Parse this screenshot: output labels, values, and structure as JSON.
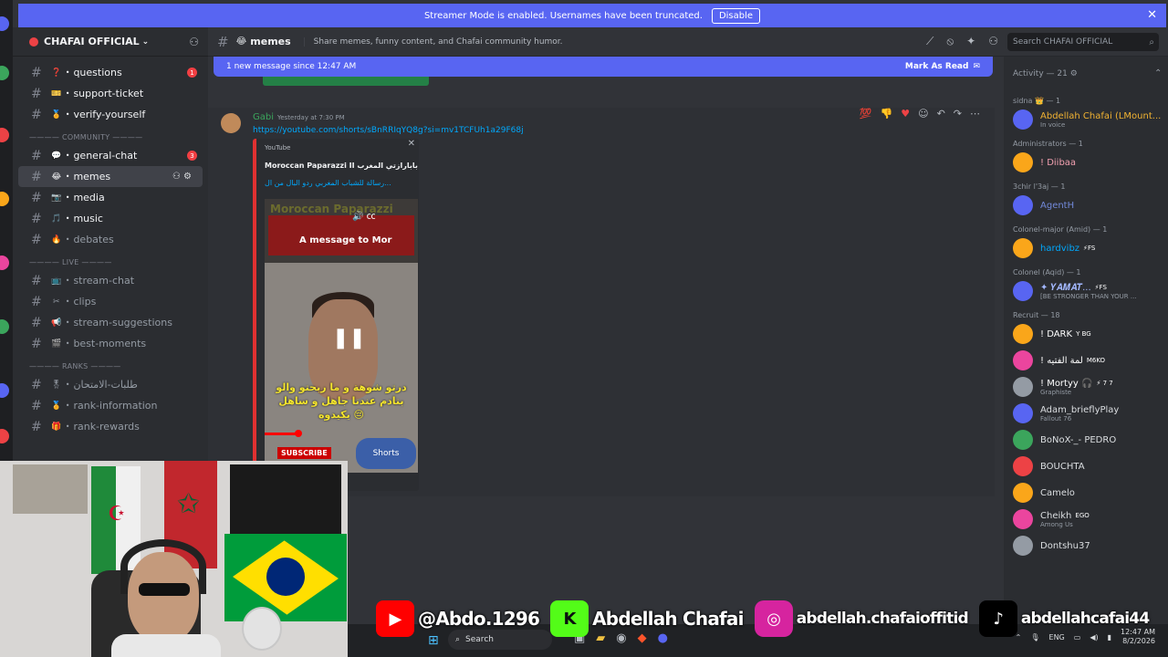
{
  "banner": {
    "text": "Streamer Mode is enabled. Usernames have been truncated.",
    "button": "Disable",
    "close": "✕"
  },
  "server": {
    "name": "CHAFAI OFFICIAL",
    "chevron": "⌄",
    "invite_icon": "person-plus-icon"
  },
  "channels": [
    {
      "type": "channel",
      "name": "questions",
      "emoji": "❓",
      "mention": "1",
      "unread": true
    },
    {
      "type": "channel",
      "name": "support-ticket",
      "emoji": "🎫",
      "unread": true
    },
    {
      "type": "channel",
      "name": "verify-yourself",
      "emoji": "🏅",
      "unread": true
    },
    {
      "type": "category",
      "name": "———— COMMUNITY ————"
    },
    {
      "type": "channel",
      "name": "general-chat",
      "emoji": "💬",
      "mention": "3",
      "unread": true
    },
    {
      "type": "channel",
      "name": "memes",
      "emoji": "😂",
      "active": true
    },
    {
      "type": "channel",
      "name": "media",
      "emoji": "📷",
      "unread": true
    },
    {
      "type": "channel",
      "name": "music",
      "emoji": "🎵",
      "unread": true
    },
    {
      "type": "channel",
      "name": "debates",
      "emoji": "🔥"
    },
    {
      "type": "category",
      "name": "———— LIVE ————"
    },
    {
      "type": "channel",
      "name": "stream-chat",
      "emoji": "📺"
    },
    {
      "type": "channel",
      "name": "clips",
      "emoji": "✂"
    },
    {
      "type": "channel",
      "name": "stream-suggestions",
      "emoji": "📢"
    },
    {
      "type": "channel",
      "name": "best-moments",
      "emoji": "🎬"
    },
    {
      "type": "category",
      "name": "———— RANKS ————"
    },
    {
      "type": "channel",
      "name": "طلبات-الامتحان",
      "emoji": "🎖"
    },
    {
      "type": "channel",
      "name": "rank-information",
      "emoji": "🏅"
    },
    {
      "type": "channel",
      "name": "rank-rewards",
      "emoji": "🎁"
    }
  ],
  "topbar": {
    "channel": "memes",
    "channel_emoji": "😂",
    "topic": "Share memes, funny content, and Chafai community humor.",
    "search_placeholder": "Search CHAFAI OFFICIAL"
  },
  "new_messages": {
    "text": "1 new message since 12:47 AM",
    "action": "Mark As Read"
  },
  "message": {
    "author": "Gabi",
    "timestamp": "Yesterday at 7:30 PM",
    "link": "https://youtube.com/shorts/sBnRRIqYQ8g?si=mv1TCFUh1a29F68j",
    "embed": {
      "provider": "YouTube",
      "title": "Moroccan Paparazzi II بابارازتي المغرب",
      "description": "رسالة للشباب المغربي ردو البال من ال...",
      "close": "✕",
      "video": {
        "channel_title": "Moroccan Paparazzi",
        "overlay": "A message to Mor",
        "subtitle": "درتو شوهة و ما ربحتو والو بنادم عندنا جاهل و ساهل يكيدوه 😔",
        "subscribe": "SUBSCRIBE",
        "shorts": "Shorts",
        "progress": 0.22
      }
    }
  },
  "members": {
    "activity": "Activity — 21",
    "groups": [
      {
        "title": "sidna 👑 — 1",
        "members": [
          {
            "name": "Abdellah Chafai (LMount...",
            "sub": "In voice",
            "color": "#f0b232"
          }
        ]
      },
      {
        "title": "Administrators — 1",
        "members": [
          {
            "name": "! Diibaa",
            "sub": "",
            "color": "#f2a0b0"
          }
        ]
      },
      {
        "title": "3chir l'3aj — 1",
        "members": [
          {
            "name": "AgentH",
            "sub": "",
            "color": "#7289da"
          }
        ]
      },
      {
        "title": "Colonel-major (Amid) — 1",
        "members": [
          {
            "name": "hardvibz",
            "tag": "⚡FS",
            "sub": "",
            "color": "#00a8fc"
          }
        ]
      },
      {
        "title": "Colonel (Aqid) — 1",
        "members": [
          {
            "name": "✦ 𝒀𝑨𝑴𝑨𝑻...",
            "tag": "⚡FS",
            "sub": "[BE STRONGER THAN YOUR ...",
            "color": "#a3b8ff"
          }
        ]
      },
      {
        "title": "Recruit — 18",
        "members": [
          {
            "name": "! DARK",
            "tag": "Y BG",
            "sub": "",
            "color": "#ffffff"
          },
          {
            "name": "! لمة الفتيه",
            "tag": "M6KO",
            "sub": "",
            "color": "#ffffff"
          },
          {
            "name": "! Mortyy 🎧",
            "tag": "⚡ 7 7",
            "sub": "Graphiste",
            "color": "#ffffff"
          },
          {
            "name": "Adam_brieflyPlay",
            "sub": "Fallout 76",
            "color": "#dbdee1"
          },
          {
            "name": "BoNoX-_- PEDRO",
            "sub": "",
            "color": "#dbdee1"
          },
          {
            "name": "BOUCHTA",
            "sub": "",
            "color": "#dbdee1"
          },
          {
            "name": "Camelo",
            "sub": "",
            "color": "#dbdee1"
          },
          {
            "name": "Cheikh",
            "tag": "EGO",
            "sub": "Among Us",
            "color": "#dbdee1"
          },
          {
            "name": "Dontshu37",
            "sub": "",
            "color": "#dbdee1"
          }
        ]
      }
    ]
  },
  "social": {
    "youtube": "@Abdo.1296",
    "kick": "Abdellah Chafai",
    "instagram": "abdellah.chafaioffitid",
    "tiktok": "abdellahcafai44"
  },
  "taskbar": {
    "search": "Search",
    "lang": "ENG",
    "time": "12:47 AM",
    "date": "8/2/2026"
  }
}
